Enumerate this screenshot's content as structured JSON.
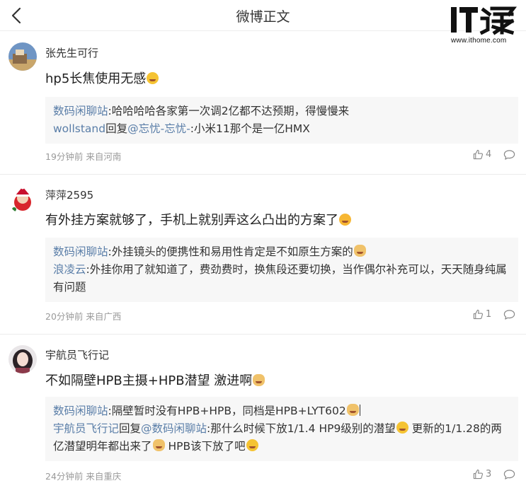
{
  "header": {
    "title": "微博正文"
  },
  "watermark": {
    "logo_it": "IT",
    "logo_cn": "之家",
    "url": "www.ithome.com"
  },
  "comments": [
    {
      "username": "张先生可行",
      "text": "hp5长焦使用无感",
      "replies": [
        {
          "name": "数码闲聊站",
          "sep": ":",
          "text": "哈哈哈哈各家第一次调2亿都不达预期，得慢慢来"
        },
        {
          "name": "wollstand",
          "mid": "回复",
          "to": "@忘忧-忘忧-",
          "sep": ":",
          "text": "小米11那个是一亿HMX"
        }
      ],
      "meta": "19分钟前 来自河南",
      "likes": "4"
    },
    {
      "username": "萍萍2595",
      "text": "有外挂方案就够了，手机上就别弄这么凸出的方案了",
      "replies": [
        {
          "name": "数码闲聊站",
          "sep": ":",
          "text": "外挂镜头的便携性和易用性肯定是不如原生方案的"
        },
        {
          "name": "浪凌云",
          "sep": ":",
          "text": "外挂你用了就知道了，费劲费时，换焦段还要切换，当作偶尔补充可以，天天随身纯属有问题"
        }
      ],
      "meta": "20分钟前 来自广西",
      "likes": "1"
    },
    {
      "username": "宇航员飞行记",
      "text": "不如隔壁HPB主摄+HPB潜望 激进啊",
      "replies": [
        {
          "name": "数码闲聊站",
          "sep": ":",
          "text": "隔壁暂时没有HPB+HPB，同档是HPB+LYT602"
        },
        {
          "name": "宇航员飞行记",
          "mid": "回复",
          "to": "@数码闲聊站",
          "sep": ":",
          "text": "那什么时候下放1/1.4 HP9级别的潜望",
          "text2": " 更新的1/1.28的两亿潜望明年都出来了",
          "text3": " HPB该下放了吧"
        }
      ],
      "meta": "24分钟前 来自重庆",
      "likes": "3"
    }
  ],
  "icons": {
    "back": "chevron-left-icon",
    "like": "thumbs-up-icon",
    "reply": "comment-bubble-icon"
  },
  "colors": {
    "link": "#5a7ea8",
    "meta": "#9a9a9a",
    "reply_bg": "#f7f7f7"
  }
}
